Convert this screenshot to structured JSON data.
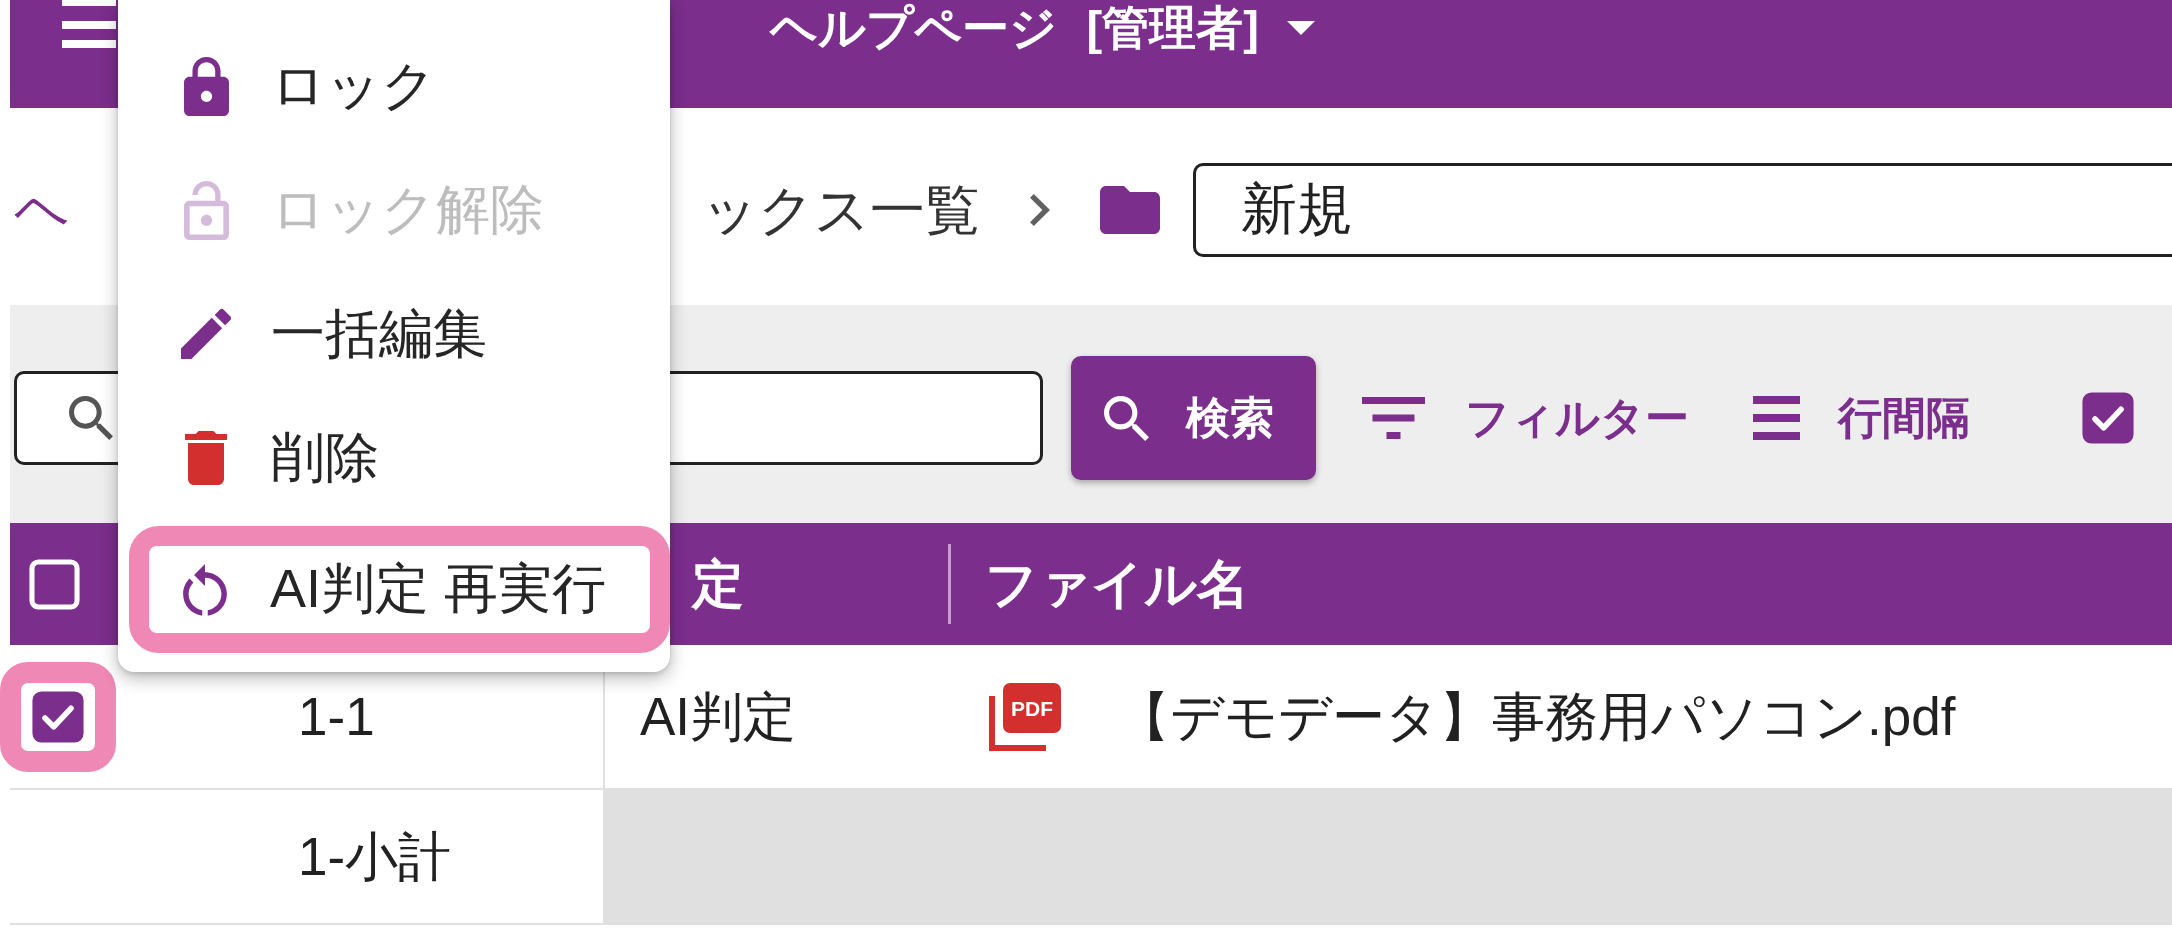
{
  "app_bar": {
    "title": "ヘルプページ [管理者]"
  },
  "breadcrumb": {
    "items": [
      {
        "kind": "link",
        "label": "ヘ"
      },
      {
        "kind": "text",
        "label": "ックス一覧"
      }
    ],
    "folder_name": "新規"
  },
  "toolbar": {
    "search_button": "検索",
    "filter_button": "フィルター",
    "density_button": "行間隔",
    "toggle": {
      "checked": true
    }
  },
  "table": {
    "select_all": {
      "checked": false
    },
    "columns": [
      {
        "label": "定"
      },
      {
        "label": "ファイル名"
      }
    ],
    "rows": [
      {
        "kind": "item",
        "checked": true,
        "highlighted": true,
        "label": "1-1",
        "column_3": "AI判定",
        "file": {
          "icon_text": "PDF",
          "name": "【デモデータ】事務用パソコン.pdf"
        }
      },
      {
        "kind": "subtotal",
        "label": "1-小計"
      }
    ]
  },
  "menu": {
    "items": [
      {
        "kind": "lock",
        "label": "ロック",
        "disabled": false,
        "highlighted": false
      },
      {
        "kind": "unlock",
        "label": "ロック解除",
        "disabled": true,
        "highlighted": false
      },
      {
        "kind": "edit",
        "label": "一括編集",
        "disabled": false,
        "highlighted": false
      },
      {
        "kind": "delete",
        "label": "削除",
        "disabled": false,
        "highlighted": false
      },
      {
        "kind": "rerun",
        "label": "AI判定 再実行",
        "disabled": false,
        "highlighted": true
      }
    ]
  }
}
